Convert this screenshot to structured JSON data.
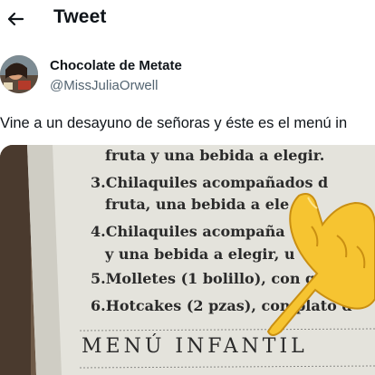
{
  "header": {
    "title": "Tweet",
    "back_icon": "arrow-left-icon"
  },
  "author": {
    "name": "Chocolate de Metate",
    "handle": "@MissJuliaOrwell",
    "avatar_icon": "profile-photo"
  },
  "tweet": {
    "text": "Vine a un desayuno de señoras y éste es el menú in"
  },
  "media": {
    "menu_lines": [
      "fruta y una bebida a elegir.",
      "3.Chilaquiles acompañados d",
      "fruta, una bebida a ele",
      "4.Chilaquiles acompaña",
      "y una bebida a elegir, u",
      "5.Molletes (1 bolillo), con g",
      "6.Hotcakes (2 pzas), con    plato d"
    ],
    "section_title": "MENÚ INFANTIL",
    "overlay_icon": "pointing-hand-emoji",
    "colors": {
      "paper": "#e4e3dc",
      "emoji": "#f6c431"
    }
  }
}
